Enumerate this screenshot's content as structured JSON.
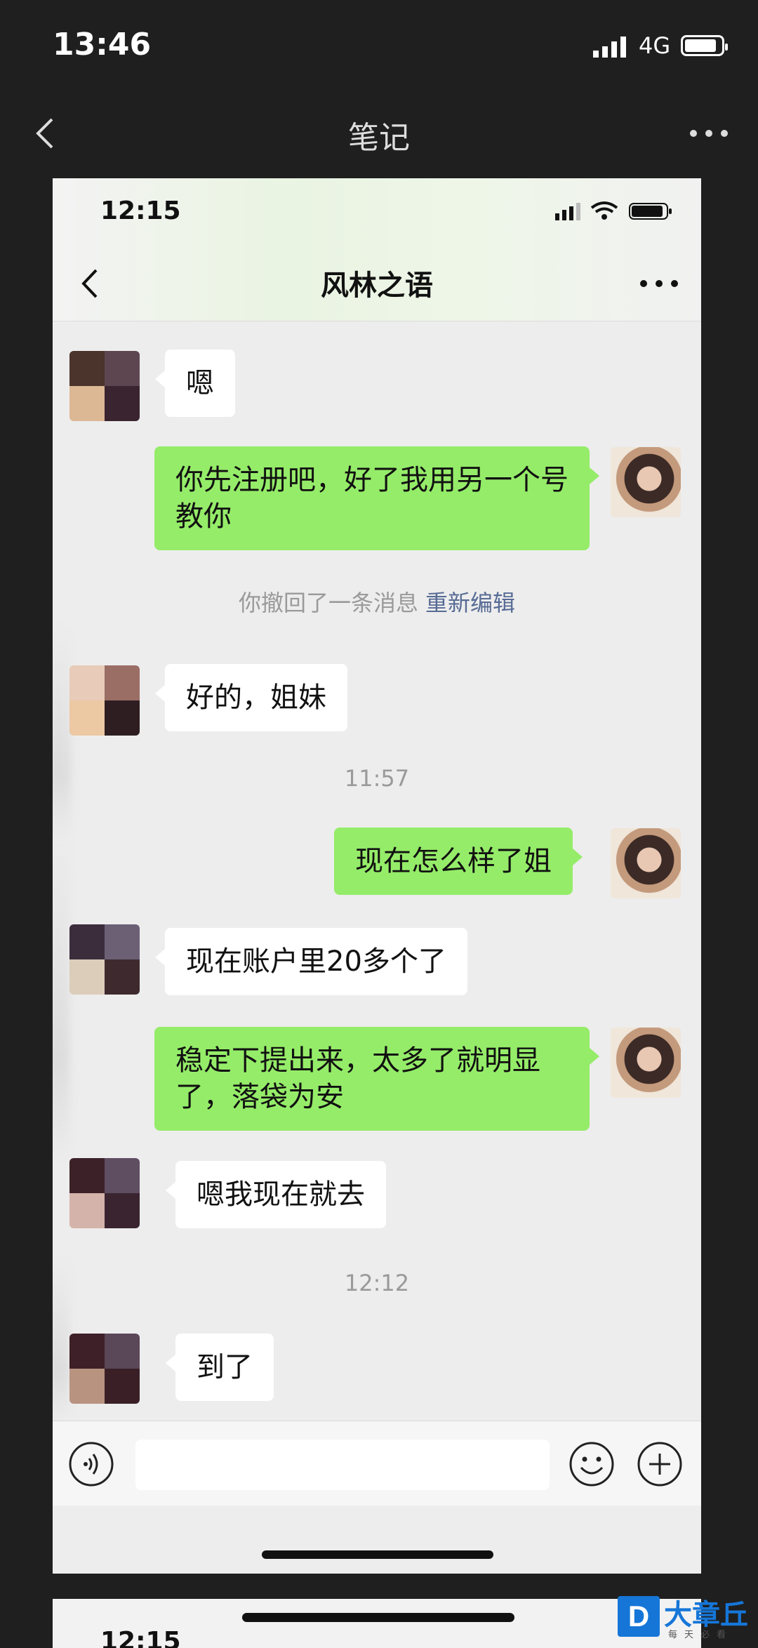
{
  "outer_status": {
    "time": "13:46",
    "network": "4G",
    "battery_level": 0.8
  },
  "notes_nav": {
    "title": "笔记",
    "back_icon": "chevron-left-icon",
    "more_icon": "more-dots-icon"
  },
  "inner_status": {
    "time": "12:15"
  },
  "chat": {
    "title": "风林之语",
    "messages": [
      {
        "side": "left",
        "text": "嗯"
      },
      {
        "side": "right",
        "text": "你先注册吧，好了我用另一个号教你"
      },
      {
        "system": "你撤回了一条消息",
        "link": "重新编辑"
      },
      {
        "side": "left",
        "text": "好的，姐妹"
      },
      {
        "time": "11:57"
      },
      {
        "side": "right",
        "text": "现在怎么样了姐"
      },
      {
        "side": "left",
        "text": "现在账户里20多个了"
      },
      {
        "side": "right",
        "text": "稳定下提出来，太多了就明显了，落袋为安"
      },
      {
        "side": "left",
        "text": "嗯我现在就去"
      },
      {
        "time": "12:12"
      },
      {
        "side": "left",
        "text": "到了"
      }
    ]
  },
  "input_bar": {
    "voice_icon": "voice-icon",
    "emoji_icon": "emoji-icon",
    "plus_icon": "plus-icon"
  },
  "second_card": {
    "time": "12:15"
  },
  "watermark": {
    "logo_letter": "D",
    "brand": "大章丘",
    "sub": "每天必看"
  },
  "colors": {
    "bubble_right": "#95ec69",
    "bubble_left": "#ffffff",
    "link": "#576b95",
    "watermark": "#1676d8"
  }
}
